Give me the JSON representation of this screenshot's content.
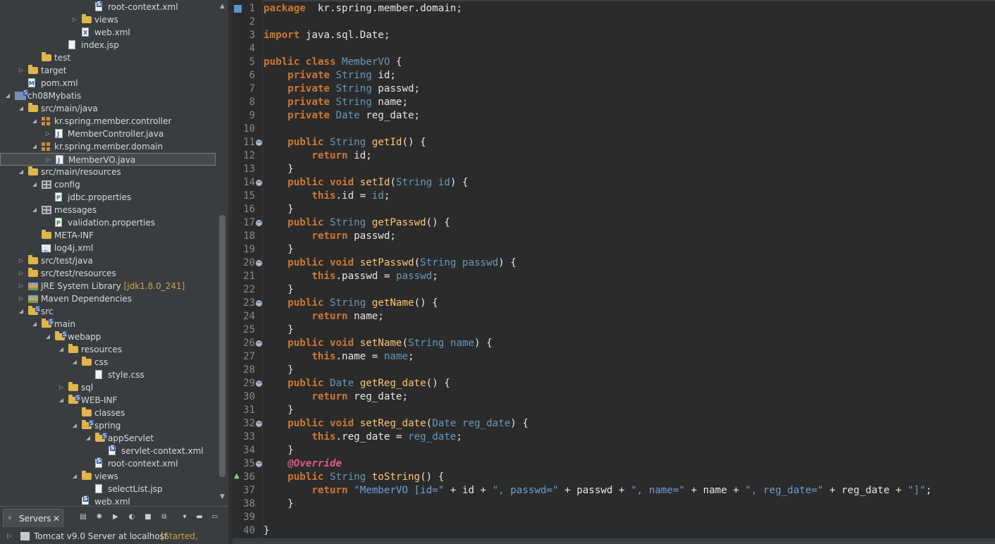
{
  "explorer": {
    "rows": [
      {
        "indent": 7,
        "twisty": "",
        "icon": "xml-s",
        "label": "root-context.xml"
      },
      {
        "indent": 6,
        "twisty": "▷",
        "icon": "folder",
        "label": "views"
      },
      {
        "indent": 6,
        "twisty": "",
        "icon": "xml",
        "label": "web.xml"
      },
      {
        "indent": 5,
        "twisty": "",
        "icon": "file",
        "label": "index.jsp"
      },
      {
        "indent": 3,
        "twisty": "",
        "icon": "folder",
        "label": "test"
      },
      {
        "indent": 2,
        "twisty": "▷",
        "icon": "folder",
        "label": "target"
      },
      {
        "indent": 2,
        "twisty": "",
        "icon": "pom",
        "label": "pom.xml"
      },
      {
        "indent": 1,
        "twisty": "◢",
        "icon": "project",
        "label": "ch08Mybatis"
      },
      {
        "indent": 2,
        "twisty": "◢",
        "icon": "folder",
        "label": "src/main/java"
      },
      {
        "indent": 3,
        "twisty": "◢",
        "icon": "pkg",
        "label": "kr.spring.member.controller"
      },
      {
        "indent": 4,
        "twisty": "▷",
        "icon": "java",
        "label": "MemberController.java"
      },
      {
        "indent": 3,
        "twisty": "◢",
        "icon": "pkg",
        "label": "kr.spring.member.domain"
      },
      {
        "indent": 4,
        "twisty": "▷",
        "icon": "java",
        "label": "MemberVO.java",
        "selected": true
      },
      {
        "indent": 2,
        "twisty": "◢",
        "icon": "folder",
        "label": "src/main/resources"
      },
      {
        "indent": 3,
        "twisty": "◢",
        "icon": "jar",
        "label": "config"
      },
      {
        "indent": 4,
        "twisty": "",
        "icon": "props",
        "label": "jdbc.properties"
      },
      {
        "indent": 3,
        "twisty": "◢",
        "icon": "jar",
        "label": "messages"
      },
      {
        "indent": 4,
        "twisty": "",
        "icon": "props",
        "label": "validation.properties"
      },
      {
        "indent": 3,
        "twisty": "",
        "icon": "folder",
        "label": "META-INF"
      },
      {
        "indent": 3,
        "twisty": "",
        "icon": "cfgxml",
        "label": "log4j.xml"
      },
      {
        "indent": 2,
        "twisty": "▷",
        "icon": "folder",
        "label": "src/test/java"
      },
      {
        "indent": 2,
        "twisty": "▷",
        "icon": "folder",
        "label": "src/test/resources"
      },
      {
        "indent": 2,
        "twisty": "▷",
        "icon": "lib",
        "label": "JRE System Library",
        "decoration": "[jdk1.8.0_241]"
      },
      {
        "indent": 2,
        "twisty": "▷",
        "icon": "lib",
        "label": "Maven Dependencies"
      },
      {
        "indent": 2,
        "twisty": "◢",
        "icon": "folder-s",
        "label": "src"
      },
      {
        "indent": 3,
        "twisty": "◢",
        "icon": "folder-s",
        "label": "main"
      },
      {
        "indent": 4,
        "twisty": "◢",
        "icon": "folder-s",
        "label": "webapp"
      },
      {
        "indent": 5,
        "twisty": "◢",
        "icon": "folder",
        "label": "resources"
      },
      {
        "indent": 6,
        "twisty": "◢",
        "icon": "folder",
        "label": "css"
      },
      {
        "indent": 7,
        "twisty": "",
        "icon": "file",
        "label": "style.css"
      },
      {
        "indent": 5,
        "twisty": "▷",
        "icon": "folder",
        "label": "sql"
      },
      {
        "indent": 5,
        "twisty": "◢",
        "icon": "folder-s",
        "label": "WEB-INF"
      },
      {
        "indent": 6,
        "twisty": "",
        "icon": "folder",
        "label": "classes"
      },
      {
        "indent": 6,
        "twisty": "◢",
        "icon": "folder-s",
        "label": "spring"
      },
      {
        "indent": 7,
        "twisty": "◢",
        "icon": "folder-s",
        "label": "appServlet"
      },
      {
        "indent": 8,
        "twisty": "",
        "icon": "xml-s",
        "label": "servlet-context.xml"
      },
      {
        "indent": 7,
        "twisty": "",
        "icon": "xml-s",
        "label": "root-context.xml"
      },
      {
        "indent": 6,
        "twisty": "◢",
        "icon": "folder",
        "label": "views"
      },
      {
        "indent": 7,
        "twisty": "",
        "icon": "file",
        "label": "selectList.jsp"
      },
      {
        "indent": 6,
        "twisty": "",
        "icon": "xml-s",
        "label": "web.xml"
      }
    ]
  },
  "servers": {
    "tab_label": "Servers",
    "server_name": "Tomcat v9.0 Server at localhost",
    "server_state": "[Started, Restart]"
  },
  "editor": {
    "lines": [
      [
        [
          "kw",
          "package"
        ],
        [
          "",
          "  kr.spring.member.domain;"
        ]
      ],
      [],
      [
        [
          "kw",
          "import"
        ],
        [
          "",
          " java.sql.Date;"
        ]
      ],
      [],
      [
        [
          "kw",
          "public class"
        ],
        [
          "",
          " "
        ],
        [
          "ty",
          "MemberVO"
        ],
        [
          "",
          " {"
        ]
      ],
      [
        [
          "",
          "    "
        ],
        [
          "kw",
          "private"
        ],
        [
          "",
          " "
        ],
        [
          "ty",
          "String"
        ],
        [
          "",
          " id;"
        ]
      ],
      [
        [
          "",
          "    "
        ],
        [
          "kw",
          "private"
        ],
        [
          "",
          " "
        ],
        [
          "ty",
          "String"
        ],
        [
          "",
          " passwd;"
        ]
      ],
      [
        [
          "",
          "    "
        ],
        [
          "kw",
          "private"
        ],
        [
          "",
          " "
        ],
        [
          "ty",
          "String"
        ],
        [
          "",
          " name;"
        ]
      ],
      [
        [
          "",
          "    "
        ],
        [
          "kw",
          "private"
        ],
        [
          "",
          " "
        ],
        [
          "ty",
          "Date"
        ],
        [
          "",
          " reg_date;"
        ]
      ],
      [],
      [
        [
          "",
          "    "
        ],
        [
          "kw",
          "public"
        ],
        [
          "",
          " "
        ],
        [
          "ty",
          "String"
        ],
        [
          "",
          " "
        ],
        [
          "fn",
          "getId"
        ],
        [
          "",
          "() {"
        ]
      ],
      [
        [
          "",
          "        "
        ],
        [
          "kw",
          "return"
        ],
        [
          "",
          " id;"
        ]
      ],
      [
        [
          "",
          "    }"
        ]
      ],
      [
        [
          "",
          "    "
        ],
        [
          "kw",
          "public void"
        ],
        [
          "",
          " "
        ],
        [
          "fn",
          "setId"
        ],
        [
          "",
          "("
        ],
        [
          "ty",
          "String"
        ],
        [
          "",
          " "
        ],
        [
          "pa",
          "id"
        ],
        [
          "",
          ") {"
        ]
      ],
      [
        [
          "",
          "        "
        ],
        [
          "kw",
          "this"
        ],
        [
          "",
          ".id = "
        ],
        [
          "pa",
          "id"
        ],
        [
          "",
          ";"
        ]
      ],
      [
        [
          "",
          "    }"
        ]
      ],
      [
        [
          "",
          "    "
        ],
        [
          "kw",
          "public"
        ],
        [
          "",
          " "
        ],
        [
          "ty",
          "String"
        ],
        [
          "",
          " "
        ],
        [
          "fn",
          "getPasswd"
        ],
        [
          "",
          "() {"
        ]
      ],
      [
        [
          "",
          "        "
        ],
        [
          "kw",
          "return"
        ],
        [
          "",
          " passwd;"
        ]
      ],
      [
        [
          "",
          "    }"
        ]
      ],
      [
        [
          "",
          "    "
        ],
        [
          "kw",
          "public void"
        ],
        [
          "",
          " "
        ],
        [
          "fn",
          "setPasswd"
        ],
        [
          "",
          "("
        ],
        [
          "ty",
          "String"
        ],
        [
          "",
          " "
        ],
        [
          "pa",
          "passwd"
        ],
        [
          "",
          ") {"
        ]
      ],
      [
        [
          "",
          "        "
        ],
        [
          "kw",
          "this"
        ],
        [
          "",
          ".passwd = "
        ],
        [
          "pa",
          "passwd"
        ],
        [
          "",
          ";"
        ]
      ],
      [
        [
          "",
          "    }"
        ]
      ],
      [
        [
          "",
          "    "
        ],
        [
          "kw",
          "public"
        ],
        [
          "",
          " "
        ],
        [
          "ty",
          "String"
        ],
        [
          "",
          " "
        ],
        [
          "fn",
          "getName"
        ],
        [
          "",
          "() {"
        ]
      ],
      [
        [
          "",
          "        "
        ],
        [
          "kw",
          "return"
        ],
        [
          "",
          " name;"
        ]
      ],
      [
        [
          "",
          "    }"
        ]
      ],
      [
        [
          "",
          "    "
        ],
        [
          "kw",
          "public void"
        ],
        [
          "",
          " "
        ],
        [
          "fn",
          "setName"
        ],
        [
          "",
          "("
        ],
        [
          "ty",
          "String"
        ],
        [
          "",
          " "
        ],
        [
          "pa",
          "name"
        ],
        [
          "",
          ") {"
        ]
      ],
      [
        [
          "",
          "        "
        ],
        [
          "kw",
          "this"
        ],
        [
          "",
          ".name = "
        ],
        [
          "pa",
          "name"
        ],
        [
          "",
          ";"
        ]
      ],
      [
        [
          "",
          "    }"
        ]
      ],
      [
        [
          "",
          "    "
        ],
        [
          "kw",
          "public"
        ],
        [
          "",
          " "
        ],
        [
          "ty",
          "Date"
        ],
        [
          "",
          " "
        ],
        [
          "fn",
          "getReg_date"
        ],
        [
          "",
          "() {"
        ]
      ],
      [
        [
          "",
          "        "
        ],
        [
          "kw",
          "return"
        ],
        [
          "",
          " reg_date;"
        ]
      ],
      [
        [
          "",
          "    }"
        ]
      ],
      [
        [
          "",
          "    "
        ],
        [
          "kw",
          "public void"
        ],
        [
          "",
          " "
        ],
        [
          "fn",
          "setReg_date"
        ],
        [
          "",
          "("
        ],
        [
          "ty",
          "Date"
        ],
        [
          "",
          " "
        ],
        [
          "pa",
          "reg_date"
        ],
        [
          "",
          ") {"
        ]
      ],
      [
        [
          "",
          "        "
        ],
        [
          "kw",
          "this"
        ],
        [
          "",
          ".reg_date = "
        ],
        [
          "pa",
          "reg_date"
        ],
        [
          "",
          ";"
        ]
      ],
      [
        [
          "",
          "    }"
        ]
      ],
      [
        [
          "",
          "    "
        ],
        [
          "an",
          "@Override"
        ]
      ],
      [
        [
          "",
          "    "
        ],
        [
          "kw",
          "public"
        ],
        [
          "",
          " "
        ],
        [
          "ty",
          "String"
        ],
        [
          "",
          " "
        ],
        [
          "fn",
          "toString"
        ],
        [
          "",
          "() {"
        ]
      ],
      [
        [
          "",
          "        "
        ],
        [
          "kw",
          "return"
        ],
        [
          "",
          " "
        ],
        [
          "st",
          "\"MemberVO [id=\""
        ],
        [
          "",
          " + id + "
        ],
        [
          "st",
          "\", passwd=\""
        ],
        [
          "",
          " + passwd + "
        ],
        [
          "st",
          "\", name=\""
        ],
        [
          "",
          " + name + "
        ],
        [
          "st",
          "\", reg_date=\""
        ],
        [
          "",
          " + reg_date + "
        ],
        [
          "st",
          "\"]\""
        ],
        [
          "",
          ";"
        ]
      ],
      [
        [
          "",
          "    }"
        ]
      ],
      [],
      [
        [
          "",
          "}"
        ]
      ]
    ],
    "fold_lines": [
      11,
      14,
      17,
      20,
      23,
      26,
      29,
      32,
      35
    ],
    "override_line": 36
  },
  "colors": {
    "keyword": "#cc7832",
    "type": "#6897bb",
    "method": "#ffc66d",
    "string": "#6a9fd6",
    "annotation": "#e05a8a"
  }
}
